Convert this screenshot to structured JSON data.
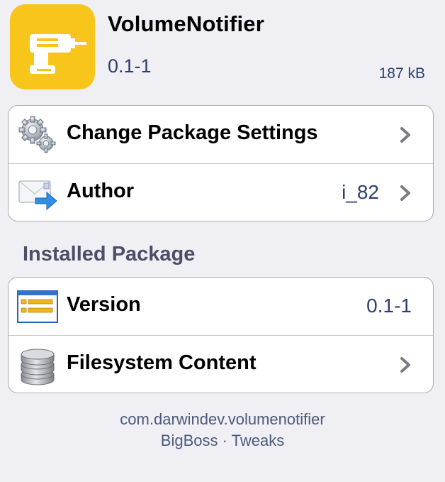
{
  "package": {
    "name": "VolumeNotifier",
    "version": "0.1-1",
    "size": "187 kB",
    "icon": "drill-icon",
    "icon_color": "#f8c51a"
  },
  "actions": [
    {
      "label": "Change Package Settings",
      "icon": "gears-icon",
      "value": ""
    },
    {
      "label": "Author",
      "icon": "mail-forward-icon",
      "value": "i_82"
    }
  ],
  "installed_section": {
    "title": "Installed Package",
    "rows": [
      {
        "label": "Version",
        "icon": "list-window-icon",
        "value": "0.1-1"
      },
      {
        "label": "Filesystem Content",
        "icon": "database-icon",
        "value": ""
      }
    ]
  },
  "footer": {
    "identifier": "com.darwindev.volumenotifier",
    "source": "BigBoss · Tweaks"
  }
}
